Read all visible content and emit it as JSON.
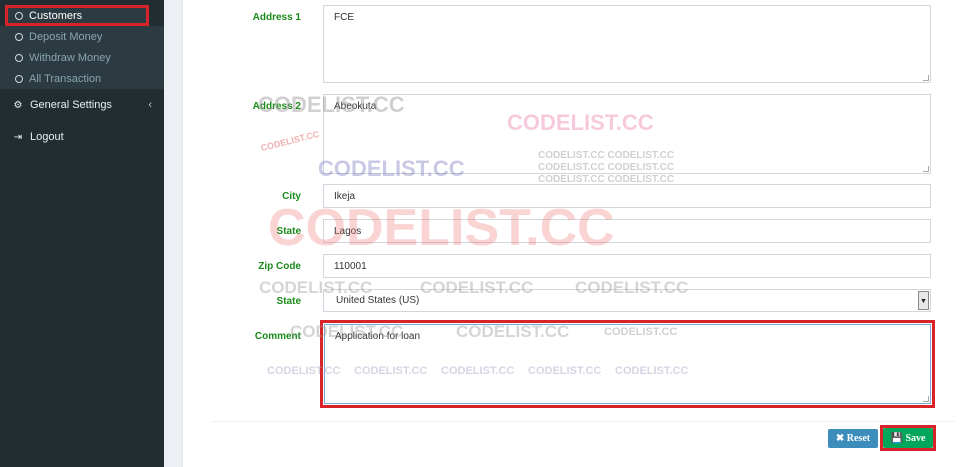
{
  "sidebar": {
    "sub_items": [
      {
        "label": "Customers",
        "active": true
      },
      {
        "label": "Deposit Money"
      },
      {
        "label": "Withdraw Money"
      },
      {
        "label": "All Transaction"
      }
    ],
    "general_settings": {
      "label": "General Settings",
      "icon": "gear-icon"
    },
    "logout": {
      "label": "Logout",
      "icon": "sign-out-icon"
    }
  },
  "form": {
    "address1": {
      "label": "Address 1",
      "value": "FCE"
    },
    "address2": {
      "label": "Address 2",
      "value": "Abeokuta"
    },
    "city": {
      "label": "City",
      "value": "Ikeja"
    },
    "state_text": {
      "label": "State",
      "value": "Lagos"
    },
    "zip": {
      "label": "Zip Code",
      "value": "110001"
    },
    "country": {
      "label": "State",
      "value": "United States (US)"
    },
    "comment": {
      "label": "Comment",
      "value": "Application for loan"
    }
  },
  "buttons": {
    "reset": "✖ Reset",
    "save": "💾 Save"
  },
  "watermark": {
    "text": "CODELIST.CC",
    "triple": "CODELIST.CC CODELIST.CC"
  },
  "colors": {
    "label_green": "#1a8a1a",
    "highlight_red": "#d9232a",
    "reset_blue": "#3c8dbc",
    "save_green": "#00a65a",
    "sidebar_bg": "#222d32"
  }
}
